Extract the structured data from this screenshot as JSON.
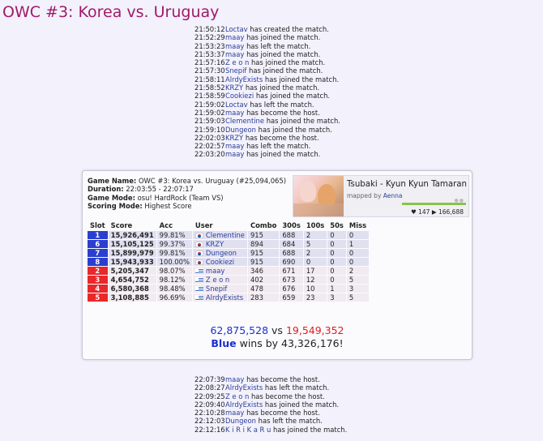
{
  "page_title": "OWC #3: Korea vs. Uruguay",
  "events_top": [
    {
      "time": "21:50:12",
      "user": "Loctav",
      "action": "has created the match."
    },
    {
      "time": "21:52:29",
      "user": "maay",
      "action": "has joined the match."
    },
    {
      "time": "21:53:23",
      "user": "maay",
      "action": "has left the match."
    },
    {
      "time": "21:53:37",
      "user": "maay",
      "action": "has joined the match."
    },
    {
      "time": "21:57:16",
      "user": "Z e o n",
      "action": "has joined the match."
    },
    {
      "time": "21:57:30",
      "user": "Snepif",
      "action": "has joined the match."
    },
    {
      "time": "21:58:11",
      "user": "AlrdyExists",
      "action": "has joined the match."
    },
    {
      "time": "21:58:52",
      "user": "KRZY",
      "action": "has joined the match."
    },
    {
      "time": "21:58:59",
      "user": "Cookiezi",
      "action": "has joined the match."
    },
    {
      "time": "21:59:02",
      "user": "Loctav",
      "action": "has left the match."
    },
    {
      "time": "21:59:02",
      "user": "maay",
      "action": "has become the host."
    },
    {
      "time": "21:59:03",
      "user": "Clementine",
      "action": "has joined the match."
    },
    {
      "time": "21:59:10",
      "user": "Dungeon",
      "action": "has joined the match."
    },
    {
      "time": "22:02:03",
      "user": "KRZY",
      "action": "has become the host."
    },
    {
      "time": "22:02:57",
      "user": "maay",
      "action": "has left the match."
    },
    {
      "time": "22:03:20",
      "user": "maay",
      "action": "has joined the match."
    }
  ],
  "game": {
    "name_label": "Game Name:",
    "name": "OWC #3: Korea vs. Uruguay (#25,094,065)",
    "duration_label": "Duration:",
    "duration": "22:03:55 - 22:07:17",
    "mode_label": "Game Mode:",
    "mode": "osu! HardRock (Team VS)",
    "scoring_label": "Scoring Mode:",
    "scoring": "Highest Score"
  },
  "beatmap": {
    "title": "Tsubaki - Kyun Kyun Tamaran Inaba",
    "mapped_by": "mapped by",
    "mapper": "Aenna",
    "favourites": "147",
    "plays": "166,688",
    "heart_icon": "heart-icon",
    "play_icon": "play-icon"
  },
  "table": {
    "headers": [
      "Slot",
      "Score",
      "Acc",
      "User",
      "Combo",
      "300s",
      "100s",
      "50s",
      "Miss"
    ],
    "rows": [
      {
        "team": "blue",
        "slot": "1",
        "score": "15,926,491",
        "acc": "99.81%",
        "flag": "kr",
        "user": "Clementine",
        "combo": "915",
        "n300": "688",
        "n100": "2",
        "n50": "0",
        "miss": "0"
      },
      {
        "team": "blue",
        "slot": "6",
        "score": "15,105,125",
        "acc": "99.37%",
        "flag": "kr",
        "user": "KRZY",
        "combo": "894",
        "n300": "684",
        "n100": "5",
        "n50": "0",
        "miss": "1"
      },
      {
        "team": "blue",
        "slot": "7",
        "score": "15,899,979",
        "acc": "99.81%",
        "flag": "kr",
        "user": "Dungeon",
        "combo": "915",
        "n300": "688",
        "n100": "2",
        "n50": "0",
        "miss": "0"
      },
      {
        "team": "blue",
        "slot": "8",
        "score": "15,943,933",
        "acc": "100.00%",
        "flag": "kr",
        "user": "Cookiezi",
        "combo": "915",
        "n300": "690",
        "n100": "0",
        "n50": "0",
        "miss": "0"
      },
      {
        "team": "red",
        "slot": "2",
        "score": "5,205,347",
        "acc": "98.07%",
        "flag": "uy",
        "user": "maay",
        "combo": "346",
        "n300": "671",
        "n100": "17",
        "n50": "0",
        "miss": "2"
      },
      {
        "team": "red",
        "slot": "3",
        "score": "4,654,752",
        "acc": "98.12%",
        "flag": "uy",
        "user": "Z e o n",
        "combo": "402",
        "n300": "673",
        "n100": "12",
        "n50": "0",
        "miss": "5"
      },
      {
        "team": "red",
        "slot": "4",
        "score": "6,580,368",
        "acc": "98.48%",
        "flag": "uy",
        "user": "Snepif",
        "combo": "478",
        "n300": "676",
        "n100": "10",
        "n50": "1",
        "miss": "3"
      },
      {
        "team": "red",
        "slot": "5",
        "score": "3,108,885",
        "acc": "96.69%",
        "flag": "uy",
        "user": "AlrdyExists",
        "combo": "283",
        "n300": "659",
        "n100": "23",
        "n50": "3",
        "miss": "5"
      }
    ]
  },
  "summary": {
    "blue_total": "62,875,528",
    "vs": "vs",
    "red_total": "19,549,352",
    "winner": "Blue",
    "wins_text": "wins by 43,326,176!"
  },
  "events_bottom": [
    {
      "time": "22:07:39",
      "user": "maay",
      "action": "has become the host."
    },
    {
      "time": "22:08:27",
      "user": "AlrdyExists",
      "action": "has left the match."
    },
    {
      "time": "22:09:25",
      "user": "Z e o n",
      "action": "has become the host."
    },
    {
      "time": "22:09:40",
      "user": "AlrdyExists",
      "action": "has joined the match."
    },
    {
      "time": "22:10:28",
      "user": "maay",
      "action": "has become the host."
    },
    {
      "time": "22:12:03",
      "user": "Dungeon",
      "action": "has left the match."
    },
    {
      "time": "22:12:16",
      "user": "K i R i K a R u",
      "action": "has joined the match."
    }
  ],
  "colors": {
    "title": "#a0196b",
    "blue_team": "#2a3fcf",
    "red_team": "#e8282a",
    "link": "#2a3f9a"
  }
}
